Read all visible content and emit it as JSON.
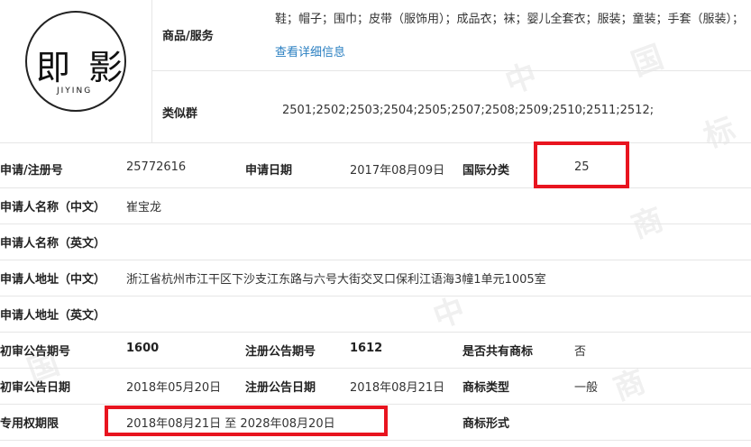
{
  "logo": {
    "mark": "即 影",
    "caption": "JIYING"
  },
  "goods": {
    "label": "商品/服务",
    "value": "鞋；帽子；围巾；皮带（服饰用）；成品衣；袜；婴儿全套衣；服装；童装；手套（服装）；",
    "detail_link": "查看详细信息"
  },
  "similar_group": {
    "label": "类似群",
    "value": "2501;2502;2503;2504;2505;2507;2508;2509;2510;2511;2512;"
  },
  "rows": {
    "reg_no_label": "申请/注册号",
    "reg_no": "25772616",
    "apply_date_label": "申请日期",
    "apply_date": "2017年08月09日",
    "intl_class_label": "国际分类",
    "intl_class": "25",
    "applicant_cn_label": "申请人名称（中文）",
    "applicant_cn": "崔宝龙",
    "applicant_en_label": "申请人名称（英文）",
    "applicant_en": "",
    "address_cn_label": "申请人地址（中文）",
    "address_cn": "浙江省杭州市江干区下沙支江东路与六号大街交叉口保利江语海3幢1单元1005室",
    "address_en_label": "申请人地址（英文）",
    "address_en": "",
    "prelim_issue_label": "初审公告期号",
    "prelim_issue": "1600",
    "reg_issue_label": "注册公告期号",
    "reg_issue": "1612",
    "shared_label": "是否共有商标",
    "shared": "否",
    "prelim_date_label": "初审公告日期",
    "prelim_date": "2018年05月20日",
    "reg_date_label": "注册公告日期",
    "reg_date": "2018年08月21日",
    "type_label": "商标类型",
    "type": "一般",
    "term_label": "专用权期限",
    "term": "2018年08月21日 至 2028年08月20日",
    "form_label": "商标形式",
    "form": ""
  },
  "colors": {
    "highlight": "#e8141f",
    "link": "#2a7fc1",
    "divider": "#e6e6e6"
  }
}
